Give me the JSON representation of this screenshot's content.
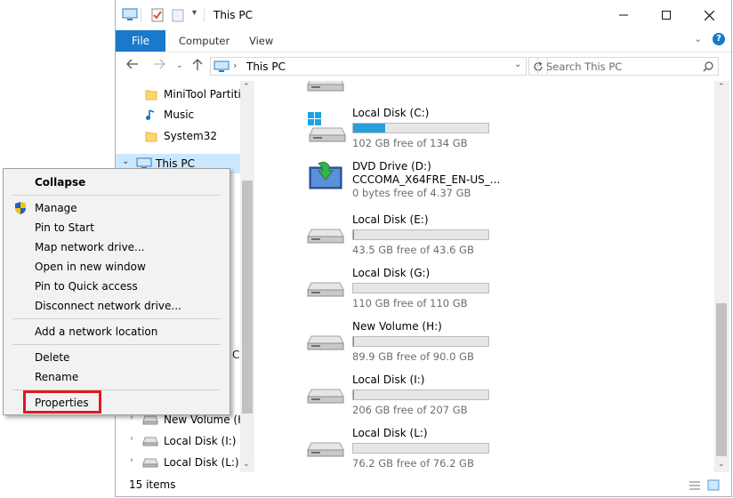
{
  "window": {
    "title": "This PC",
    "ribbon_tabs": [
      "File",
      "Computer",
      "View"
    ]
  },
  "address_bar": {
    "path": "This PC"
  },
  "search": {
    "placeholder": "Search This PC"
  },
  "nav_pane": {
    "items": [
      {
        "label": "MiniTool Partitic",
        "icon": "folder-icon"
      },
      {
        "label": "Music",
        "icon": "music-icon"
      },
      {
        "label": "System32",
        "icon": "folder-icon"
      },
      {
        "label": "This PC",
        "icon": "computer-icon",
        "selected": true
      },
      {
        "label": "New Volume (H:",
        "icon": "drive-icon"
      },
      {
        "label": "Local Disk (I:)",
        "icon": "drive-icon"
      },
      {
        "label": "Local Disk (L:)",
        "icon": "drive-icon"
      }
    ],
    "partial_text": "C"
  },
  "drives": [
    {
      "name": "Local Disk (C:)",
      "free": "102 GB free of 134 GB",
      "used_fraction": 0.24,
      "icon": "windows-drive-icon"
    },
    {
      "name": "DVD Drive (D:)\nCCCOMA_X64FRE_EN-US_...",
      "name_line1": "DVD Drive (D:)",
      "name_line2": "CCCOMA_X64FRE_EN-US_...",
      "free": "0 bytes free of 4.37 GB",
      "icon": "dvd-drive-icon"
    },
    {
      "name": "Local Disk (E:)",
      "free": "43.5 GB free of 43.6 GB",
      "used_fraction": 0.002,
      "icon": "drive-icon"
    },
    {
      "name": "Local Disk (G:)",
      "free": "110 GB free of 110 GB",
      "used_fraction": 0.0,
      "icon": "drive-icon"
    },
    {
      "name": "New Volume (H:)",
      "free": "89.9 GB free of 90.0 GB",
      "used_fraction": 0.001,
      "icon": "drive-icon"
    },
    {
      "name": "Local Disk (I:)",
      "free": "206 GB free of 207 GB",
      "used_fraction": 0.005,
      "icon": "drive-icon"
    },
    {
      "name": "Local Disk (L:)",
      "free": "76.2 GB free of 76.2 GB",
      "used_fraction": 0.0,
      "icon": "drive-icon"
    }
  ],
  "status": {
    "items_count": "15 items"
  },
  "context_menu": {
    "items": [
      {
        "label": "Collapse",
        "bold": true
      },
      {
        "label": "Manage",
        "icon": "shield-icon"
      },
      {
        "label": "Pin to Start"
      },
      {
        "label": "Map network drive..."
      },
      {
        "label": "Open in new window"
      },
      {
        "label": "Pin to Quick access"
      },
      {
        "label": "Disconnect network drive..."
      },
      {
        "label": "Add a network location"
      },
      {
        "label": "Delete"
      },
      {
        "label": "Rename"
      },
      {
        "label": "Properties",
        "highlighted": true
      }
    ]
  },
  "colors": {
    "accent": "#1979ca",
    "selection": "#cce8ff",
    "drive_fill": "#26a0da",
    "highlight_box": "#e0191f"
  }
}
